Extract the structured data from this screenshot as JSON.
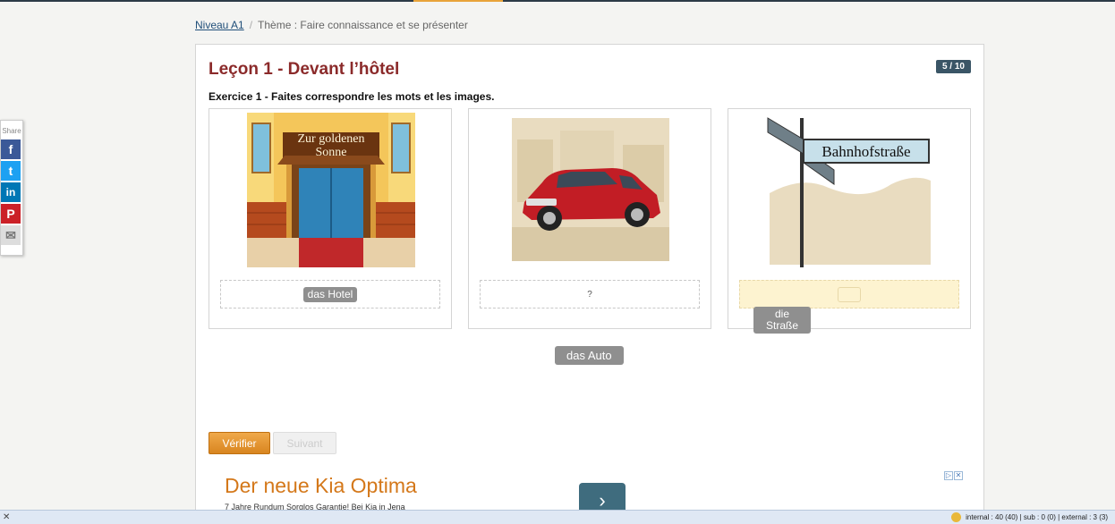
{
  "breadcrumb": {
    "level": "Niveau A1",
    "separator": "/",
    "theme": "Thème : Faire connaissance et se présenter"
  },
  "lesson": {
    "title": "Leçon 1 - Devant l’hôtel",
    "counter": "5 / 10"
  },
  "exercise": {
    "instruction": "Exercice 1 - Faites correspondre les mots et les images."
  },
  "cards": [
    {
      "sign_line1": "Zur goldenen",
      "sign_line2": "Sonne",
      "drop": "das Hotel"
    },
    {
      "drop": "?"
    },
    {
      "sign": "Bahnhofstraße",
      "drop": ""
    }
  ],
  "tiles": {
    "strasse_line1": "die",
    "strasse_line2": "Straße",
    "auto": "das Auto"
  },
  "buttons": {
    "verify": "Vérifier",
    "next": "Suivant"
  },
  "ad": {
    "title": "Der neue Kia Optima",
    "subtitle": "7 Jahre Rundum Sorglos Garantie! Bei Kia in Jena",
    "arrow": "›",
    "adchoices": "▷",
    "close": "✕"
  },
  "share": {
    "label": "Share",
    "icons": [
      "f",
      "t",
      "in",
      "P",
      "✉"
    ]
  },
  "colors": {
    "title": "#8b2a2a",
    "accent": "#e8a33a",
    "facebook": "#3b5998",
    "twitter": "#1da1f2",
    "linkedin": "#0077b5",
    "pinterest": "#cb2027"
  },
  "status": {
    "close": "✕",
    "info": "internal : 40 (40) | sub : 0 (0) | external : 3 (3)"
  }
}
